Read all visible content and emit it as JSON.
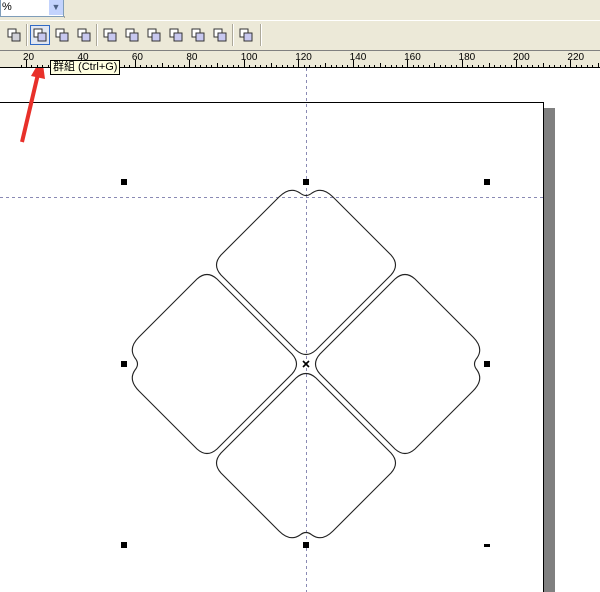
{
  "zoom_dropdown": {
    "value": "%"
  },
  "toolbar": {
    "buttons": [
      {
        "name": "combine-button"
      },
      {
        "name": "group-button",
        "active": true
      },
      {
        "name": "ungroup-button"
      },
      {
        "name": "ungroup-all-button"
      },
      {
        "name": "weld-button"
      },
      {
        "name": "trim-button"
      },
      {
        "name": "intersect-button"
      },
      {
        "name": "simplify-button"
      },
      {
        "name": "front-minus-back-button"
      },
      {
        "name": "back-minus-front-button"
      },
      {
        "name": "create-boundary-button"
      }
    ]
  },
  "ruler": {
    "labels": [
      "20",
      "40",
      "60",
      "80",
      "100",
      "120",
      "140",
      "160",
      "180",
      "200",
      "220"
    ]
  },
  "tooltip": {
    "text": "群組 (Ctrl+G)"
  },
  "colors": {
    "arrow": "#e8302a",
    "guide": "#8a8ab4",
    "shadow": "#808080",
    "toolbar": "#ece9d8"
  }
}
